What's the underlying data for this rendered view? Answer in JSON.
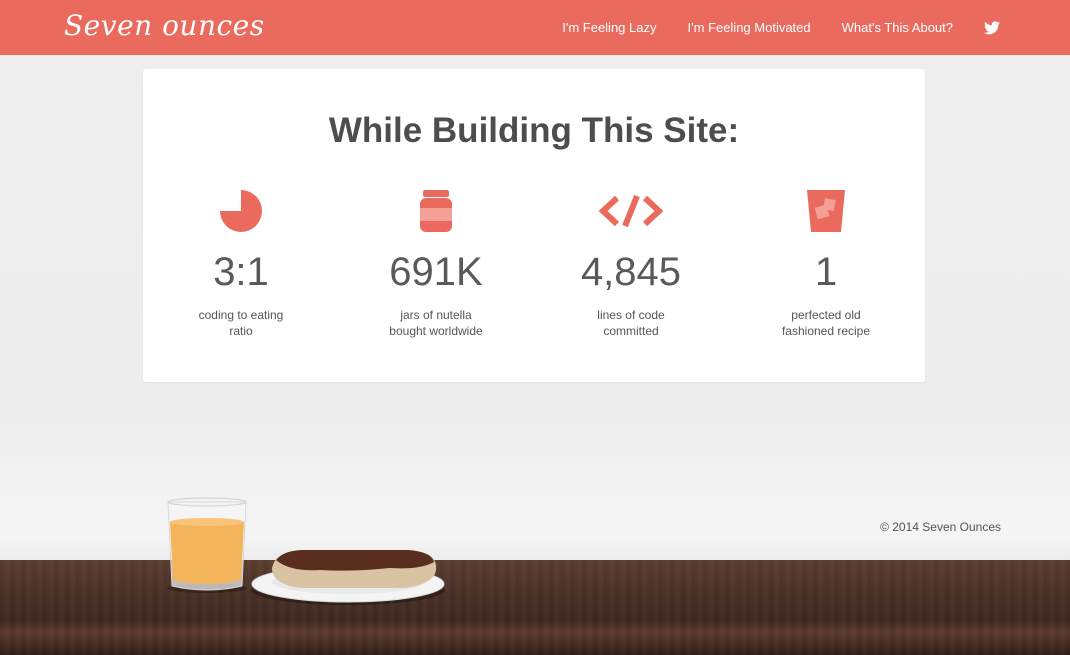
{
  "header": {
    "logo": "Seven ounces",
    "nav": [
      {
        "label": "I'm Feeling Lazy"
      },
      {
        "label": "I'm Feeling Motivated"
      },
      {
        "label": "What's This About?"
      }
    ],
    "twitter_icon": "twitter-icon"
  },
  "card": {
    "title": "While Building This Site:",
    "stats": [
      {
        "icon": "pie-chart-icon",
        "value": "3:1",
        "label_line1": "coding to eating",
        "label_line2": "ratio"
      },
      {
        "icon": "jar-icon",
        "value": "691K",
        "label_line1": "jars of nutella",
        "label_line2": "bought worldwide"
      },
      {
        "icon": "code-icon",
        "value": "4,845",
        "label_line1": "lines of code",
        "label_line2": "committed"
      },
      {
        "icon": "glass-icon",
        "value": "1",
        "label_line1": "perfected old",
        "label_line2": "fashioned recipe"
      }
    ]
  },
  "footer": {
    "copyright": "© 2014 Seven Ounces"
  },
  "colors": {
    "brand": "#ea6b5d",
    "title": "#4d4d4d",
    "text": "#555555"
  }
}
